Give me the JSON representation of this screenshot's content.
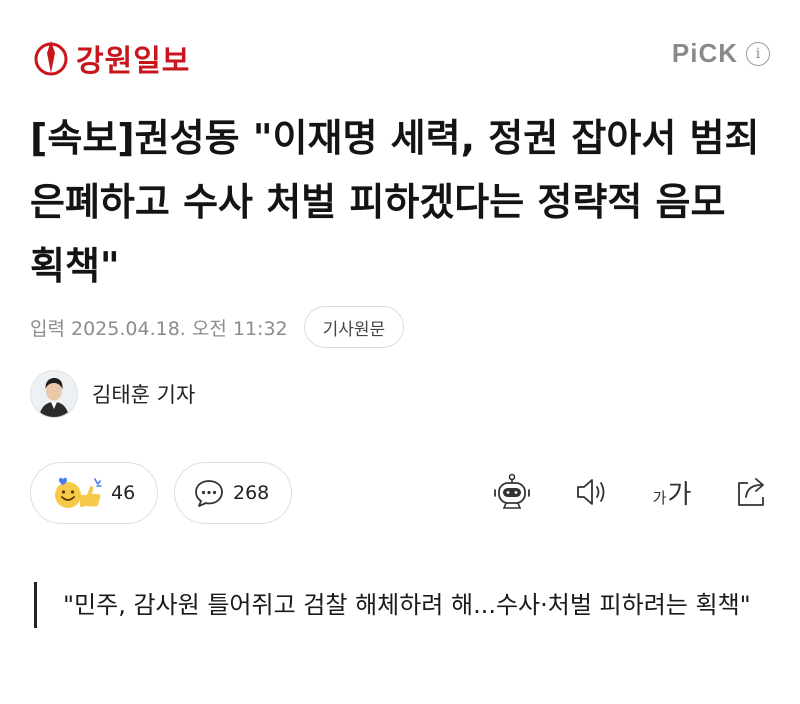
{
  "header": {
    "logo_text": "강원일보",
    "pick_label": "PiCK",
    "info_icon": "info-icon"
  },
  "colors": {
    "brand_red": "#c8161d",
    "muted_gray": "#8c8c8c"
  },
  "article": {
    "headline": "[속보]권성동 \"이재명 세력, 정권 잡아서 범죄 은폐하고 수사 처벌 피하겠다는 정략적 음모 획책\"",
    "date": "입력 2025.04.18. 오전 11:32",
    "original_button": "기사원문",
    "reporter": "김태훈 기자",
    "subheading": "\"민주, 감사원 틀어쥐고 검찰 해체하려 해...수사·처벌 피하려는 획책\""
  },
  "reactions": {
    "like_count": "46",
    "comment_count": "268"
  },
  "tools": {
    "font_size_big": "가",
    "font_size_small": "가"
  }
}
